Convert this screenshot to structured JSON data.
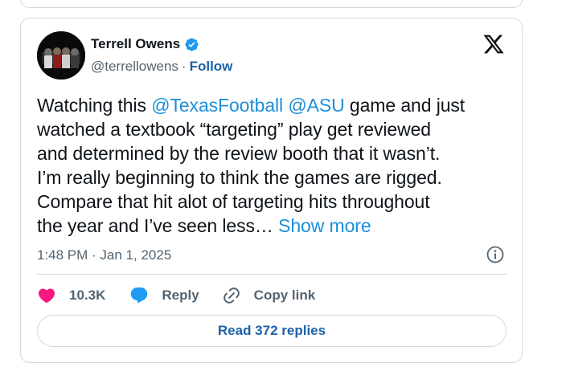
{
  "author": {
    "name": "Terrell Owens",
    "handle": "@terrellowens",
    "separator": "·",
    "follow_label": "Follow"
  },
  "tweet": {
    "lines": [
      [
        {
          "t": "Watching this ",
          "k": "text"
        },
        {
          "t": "@TexasFootball",
          "k": "mention"
        },
        {
          "t": " ",
          "k": "text"
        },
        {
          "t": "@ASU",
          "k": "mention"
        },
        {
          "t": " game and just",
          "k": "text"
        }
      ],
      [
        {
          "t": "watched a textbook “targeting” play get reviewed",
          "k": "text"
        }
      ],
      [
        {
          "t": "and determined by the review booth that it wasn’t.",
          "k": "text"
        }
      ],
      [
        {
          "t": "I’m really beginning to think the games are rigged.",
          "k": "text"
        }
      ],
      [
        {
          "t": "Compare that hit alot of targeting hits throughout",
          "k": "text"
        }
      ],
      [
        {
          "t": "the year and I’ve seen less… ",
          "k": "text"
        },
        {
          "t": "Show more",
          "k": "show-more"
        }
      ]
    ],
    "timestamp": "1:48 PM · Jan 1, 2025"
  },
  "actions": {
    "like_count": "10.3K",
    "reply_label": "Reply",
    "copy_link_label": "Copy link"
  },
  "read_replies_label": "Read 372 replies",
  "colors": {
    "accent": "#1d9bf0",
    "like": "#f91880",
    "follow": "#1d62a8",
    "verified": "#1d9bf0"
  },
  "icons": [
    "verified-badge-icon",
    "x-logo-icon",
    "info-icon",
    "heart-icon",
    "reply-bubble-icon",
    "link-icon"
  ]
}
